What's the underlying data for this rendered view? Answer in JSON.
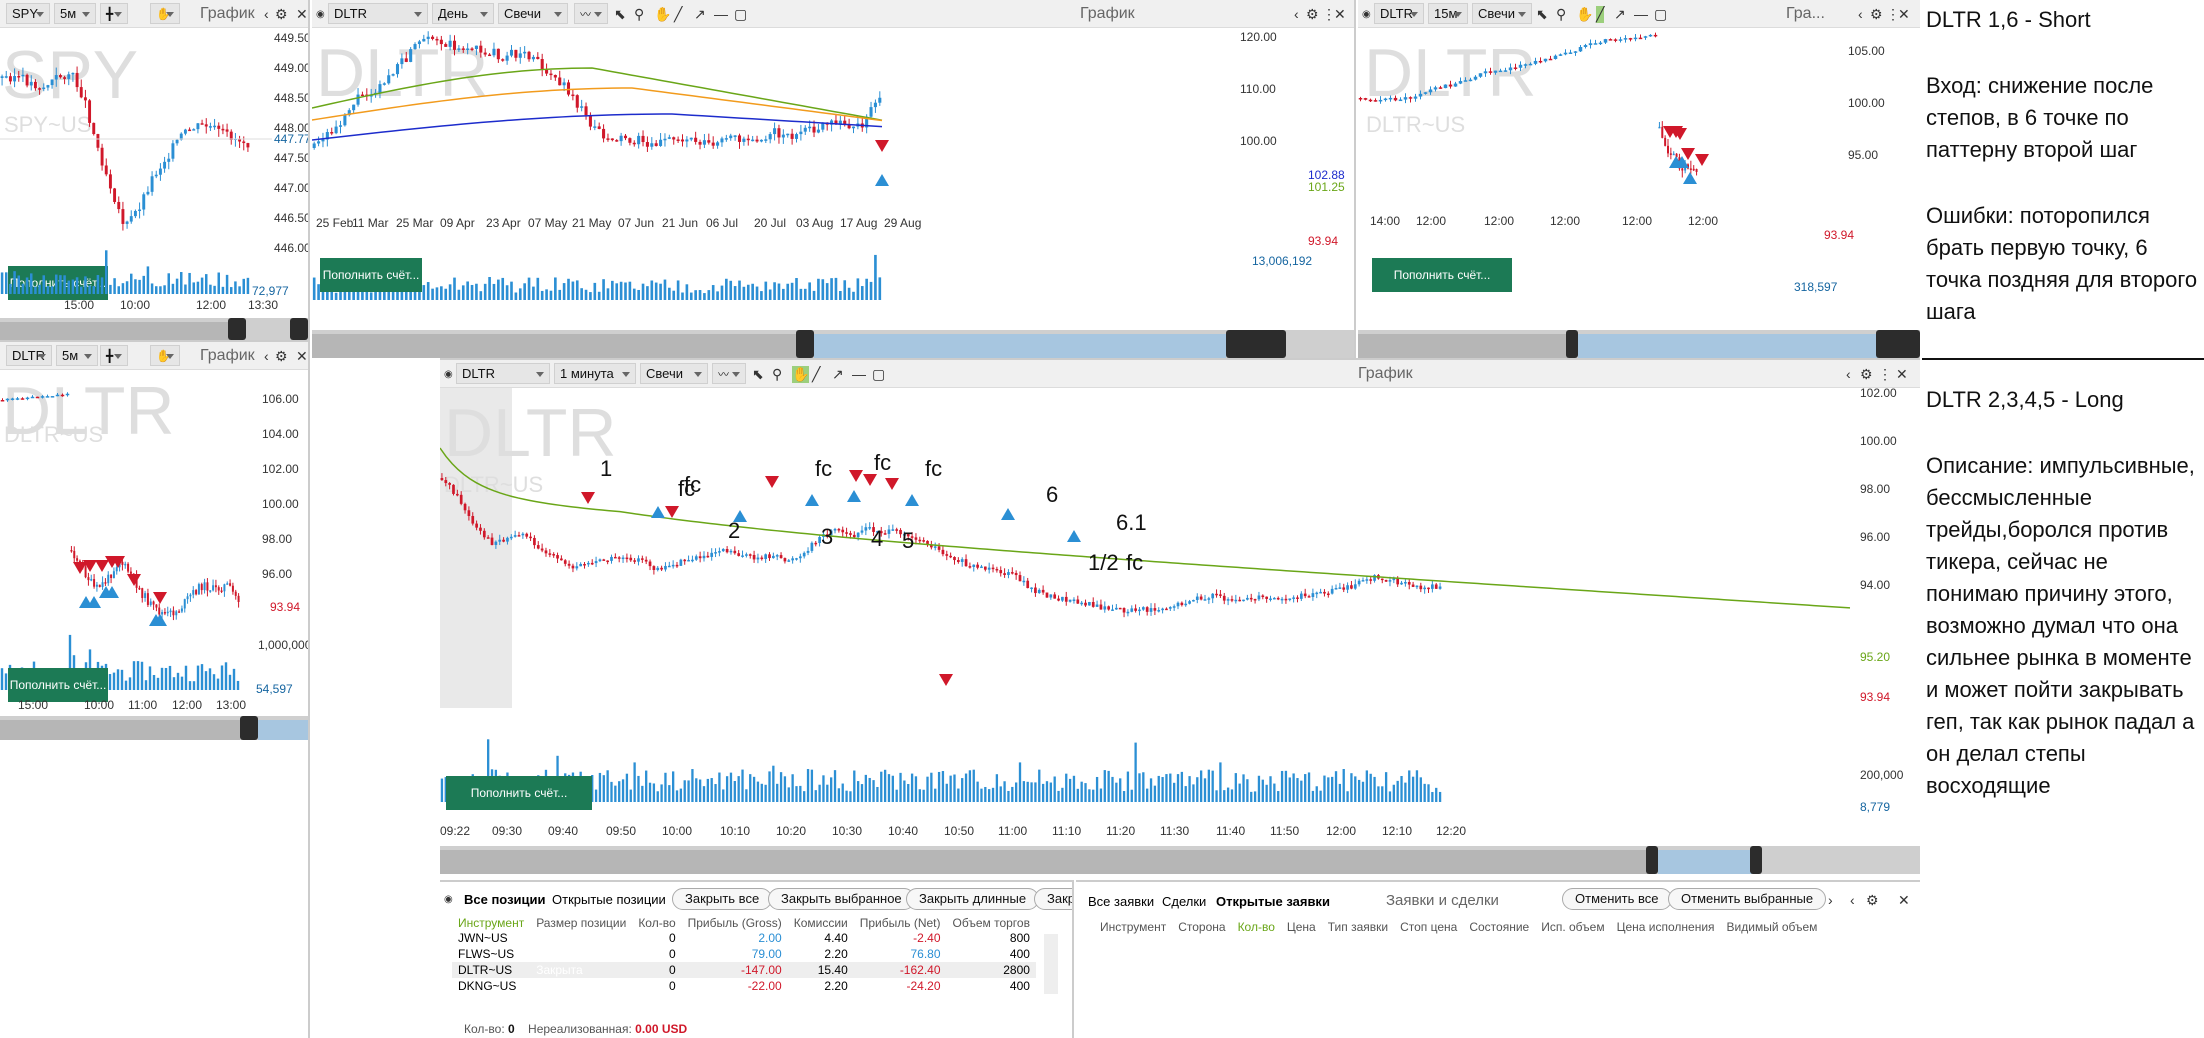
{
  "panels": {
    "spy": {
      "symbol": "SPY",
      "interval": "5м",
      "title": "График",
      "watermark": "SPY",
      "watermark_sub": "SPY~US",
      "prices": [
        "449.50",
        "449.00",
        "448.50",
        "448.00",
        "447.50",
        "447.00",
        "446.50",
        "446.00"
      ],
      "last_price": "447.77",
      "volume": "72,977",
      "times": [
        "15:00",
        "10:00",
        "12:00",
        "13:30"
      ],
      "replenish": "Пополнить счёт..."
    },
    "dltr_5m": {
      "symbol": "DLTR",
      "interval": "5м",
      "title": "График",
      "watermark": "DLTR",
      "watermark_sub": "DLTR~US",
      "prices": [
        "106.00",
        "104.00",
        "102.00",
        "100.00",
        "98.00",
        "96.00"
      ],
      "last_price": "93.94",
      "vol_axis": "1,000,000",
      "volume": "54,597",
      "times": [
        "15:00",
        "10:00",
        "11:00",
        "12:00",
        "13:00"
      ],
      "replenish": "Пополнить счёт..."
    },
    "dltr_day": {
      "symbol": "DLTR",
      "interval": "День",
      "style": "Свечи",
      "title": "График",
      "watermark": "DLTR",
      "prices": [
        "120.00",
        "110.00",
        "100.00"
      ],
      "ma_values": [
        "102.88",
        "101.25"
      ],
      "last_price": "93.94",
      "volume": "13,006,192",
      "dates": [
        "25 Feb",
        "11 Mar",
        "25 Mar",
        "09 Apr",
        "23 Apr",
        "07 May",
        "21 May",
        "07 Jun",
        "21 Jun",
        "06 Jul",
        "20 Jul",
        "03 Aug",
        "17 Aug",
        "29 Aug"
      ],
      "replenish": "Пополнить счёт..."
    },
    "dltr_15m": {
      "symbol": "DLTR",
      "interval": "15м",
      "style": "Свечи",
      "title": "Гра...",
      "watermark": "DLTR",
      "watermark_sub": "DLTR~US",
      "prices": [
        "105.00",
        "100.00",
        "95.00"
      ],
      "last_price": "93.94",
      "volume": "318,597",
      "times": [
        "14:00",
        "12:00",
        "12:00",
        "12:00",
        "12:00",
        "12:00"
      ],
      "replenish": "Пополнить счёт..."
    },
    "dltr_1m": {
      "symbol": "DLTR",
      "interval": "1 минута",
      "style": "Свечи",
      "title": "График",
      "watermark": "DLTR",
      "watermark_sub": "DLTR~US",
      "prices": [
        "102.00",
        "100.00",
        "98.00",
        "96.00",
        "94.00"
      ],
      "ma_value": "95.20",
      "last_price": "93.94",
      "vol_axis": "200,000",
      "volume": "8,779",
      "times": [
        "09:22",
        "09:30",
        "09:40",
        "09:50",
        "10:00",
        "10:10",
        "10:20",
        "10:30",
        "10:40",
        "10:50",
        "11:00",
        "11:10",
        "11:20",
        "11:30",
        "11:40",
        "11:50",
        "12:00",
        "12:10",
        "12:20"
      ],
      "annotations": [
        "1",
        "fc",
        "fc",
        "2",
        "3",
        "fc",
        "4",
        "fc",
        "fc",
        "5",
        "6",
        "6.1",
        "1/2",
        "fc"
      ],
      "replenish": "Пополнить счёт..."
    }
  },
  "positions": {
    "tabs": [
      "Все позиции",
      "Открытые позиции"
    ],
    "buttons": [
      "Закрыть все",
      "Закрыть выбранное",
      "Закрыть длинные",
      "Закрыт"
    ],
    "columns": [
      "Инструмент",
      "Размер позиции",
      "Кол-во",
      "Прибыль (Gross)",
      "Комиссии",
      "Прибыль (Net)",
      "Объем торгов"
    ],
    "rows": [
      {
        "symbol": "JWN~US",
        "size": "",
        "qty": "0",
        "gross": "2.00",
        "fee": "4.40",
        "net": "-2.40",
        "vol": "800"
      },
      {
        "symbol": "FLWS~US",
        "size": "",
        "qty": "0",
        "gross": "79.00",
        "fee": "2.20",
        "net": "76.80",
        "vol": "400"
      },
      {
        "symbol": "DLTR~US",
        "size": "Закрыта",
        "qty": "0",
        "gross": "-147.00",
        "fee": "15.40",
        "net": "-162.40",
        "vol": "2800"
      },
      {
        "symbol": "DKNG~US",
        "size": "",
        "qty": "0",
        "gross": "-22.00",
        "fee": "2.20",
        "net": "-24.20",
        "vol": "400"
      }
    ],
    "footer_qty_label": "Кол-во:",
    "footer_qty": "0",
    "footer_unreal_label": "Нереализованная:",
    "footer_unreal": "0.00 USD"
  },
  "orders": {
    "tabs": [
      "Все заявки",
      "Сделки",
      "Открытые заявки"
    ],
    "title": "Заявки и сделки",
    "buttons": [
      "Отменить все",
      "Отменить выбранные"
    ],
    "columns": [
      "Инструмент",
      "Сторона",
      "Кол-во",
      "Цена",
      "Тип заявки",
      "Стоп цена",
      "Состояние",
      "Исп. объем",
      "Цена исполнения",
      "Видимый объем"
    ]
  },
  "notes": {
    "short_title": "DLTR 1,6 - Short",
    "short_entry": "Вход: снижение после степов, в 6 точке по паттерну второй шаг",
    "short_errors": "Ошибки: поторопился брать первую точку, 6 точка поздняя для второго шага",
    "long_title": "DLTR 2,3,4,5 - Long",
    "long_desc": "Описание: импульсивные, бессмысленные трейды,боролся против тикера, сейчас не понимаю причину этого, возможно думал что она сильнее рынка в моменте и может пойти закрывать геп, так как рынок падал а он делал степы восходящие"
  },
  "colors": {
    "up": "#2b8fd4",
    "down": "#d0182a",
    "ma_green": "#6aa618",
    "ma_orange": "#f29b1d",
    "ma_blue": "#1d2ccc",
    "button_green": "#1c7a55"
  }
}
